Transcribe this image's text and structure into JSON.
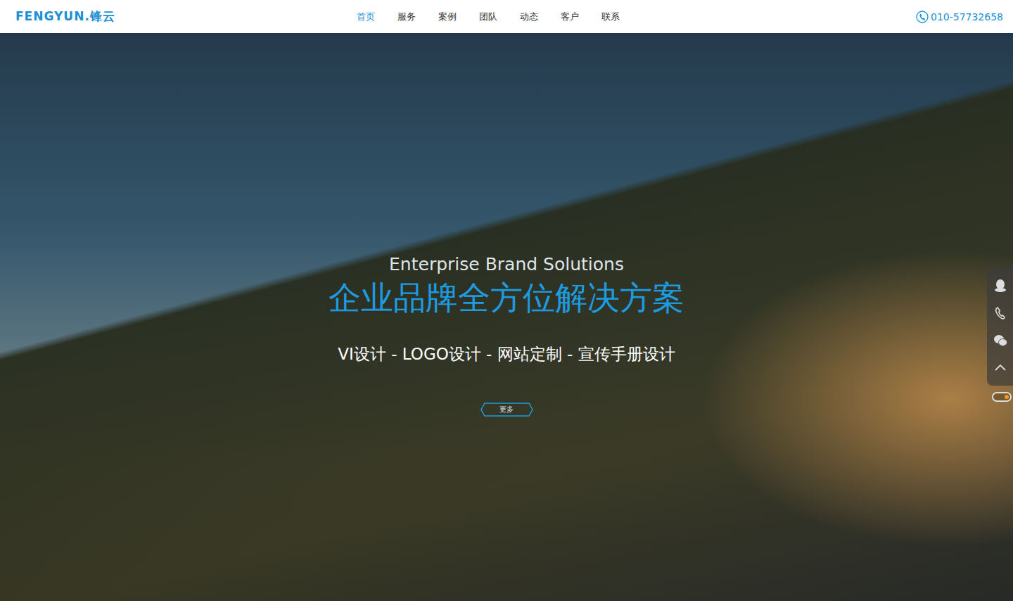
{
  "header": {
    "logo": "FENGYUN.锋云",
    "nav": [
      {
        "label": "首页",
        "selected": true
      },
      {
        "label": "服务",
        "selected": false
      },
      {
        "label": "案例",
        "selected": false
      },
      {
        "label": "团队",
        "selected": false
      },
      {
        "label": "动态",
        "selected": false
      },
      {
        "label": "客户",
        "selected": false
      },
      {
        "label": "联系",
        "selected": false
      }
    ],
    "phone": "010-57732658"
  },
  "hero": {
    "subtitle_en": "Enterprise Brand Solutions",
    "title": "企业品牌全方位解决方案",
    "services": "VI设计 - LOGO设计 - 网站定制 - 宣传手册设计",
    "button": "更多"
  }
}
